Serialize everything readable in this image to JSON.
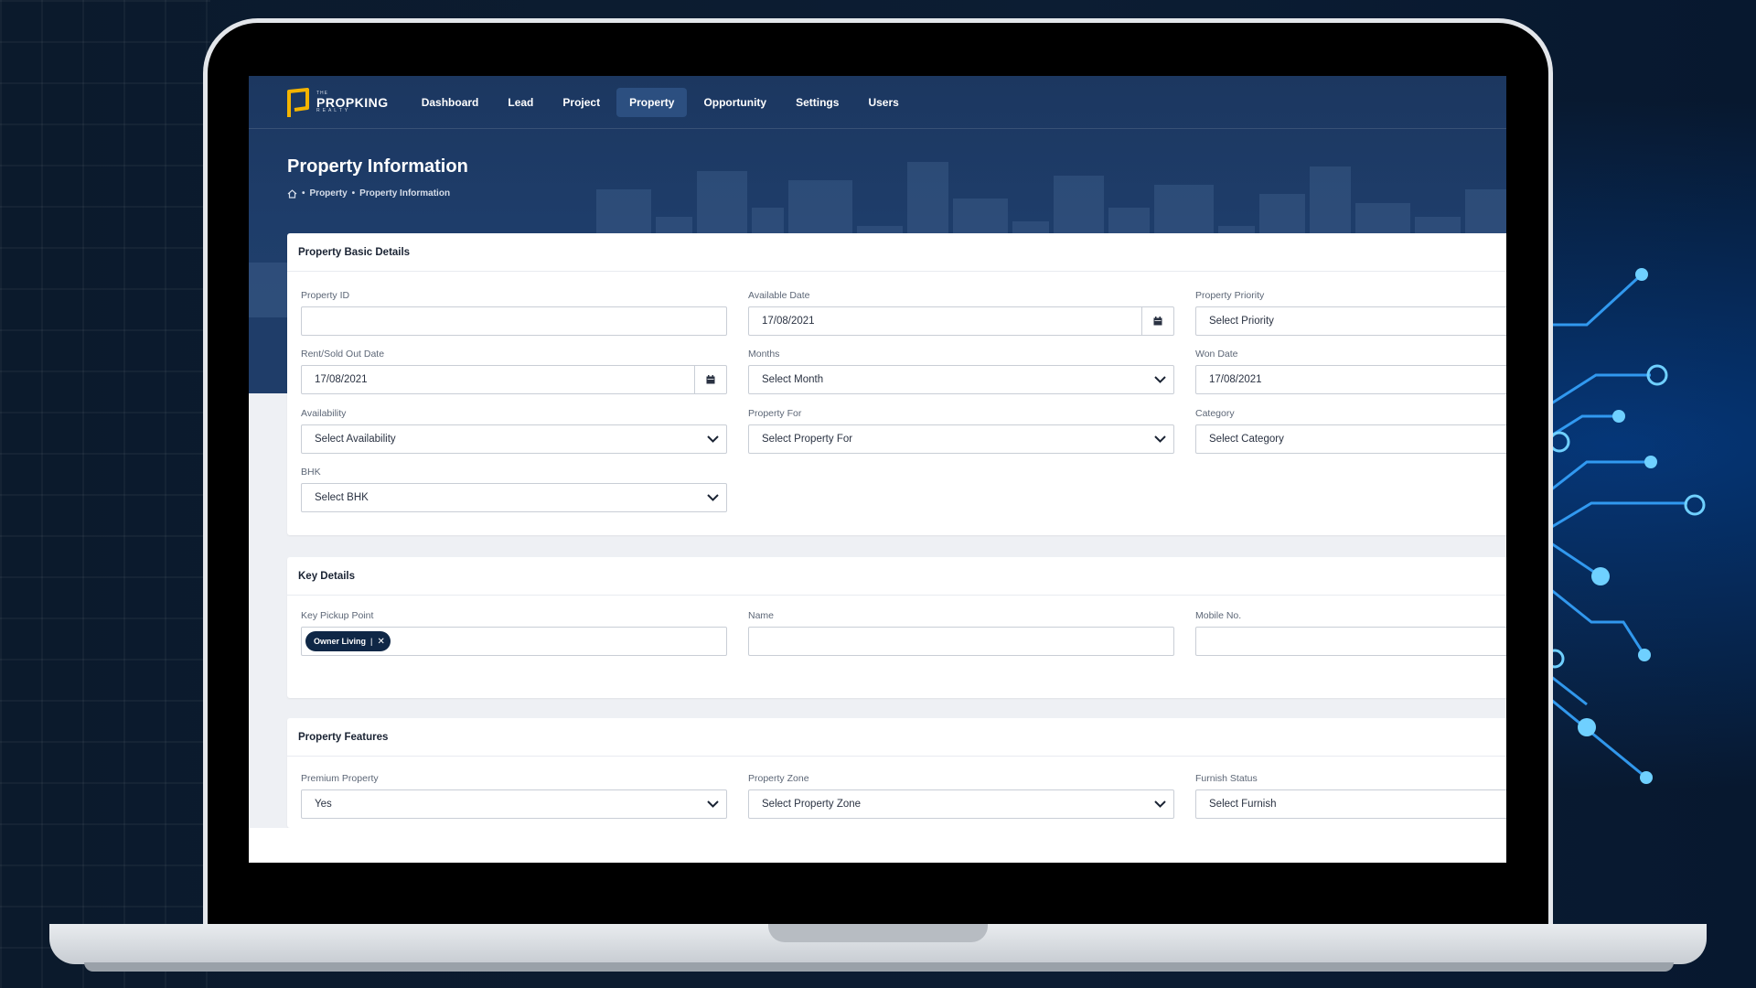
{
  "nav": {
    "logo": {
      "the": "THE",
      "main": "PROPKING",
      "sub": "REALTY"
    },
    "items": [
      {
        "label": "Dashboard",
        "active": false
      },
      {
        "label": "Lead",
        "active": false
      },
      {
        "label": "Project",
        "active": false
      },
      {
        "label": "Property",
        "active": true
      },
      {
        "label": "Opportunity",
        "active": false
      },
      {
        "label": "Settings",
        "active": false
      },
      {
        "label": "Users",
        "active": false
      }
    ]
  },
  "page": {
    "title": "Property Information",
    "breadcrumb": [
      "Property",
      "Property Information"
    ]
  },
  "basic_details": {
    "title": "Property Basic Details",
    "property_id": {
      "label": "Property ID",
      "value": ""
    },
    "available_date": {
      "label": "Available Date",
      "value": "17/08/2021"
    },
    "property_priority": {
      "label": "Property Priority",
      "value": "Select Priority"
    },
    "rent_sold_out_date": {
      "label": "Rent/Sold Out Date",
      "value": "17/08/2021"
    },
    "months": {
      "label": "Months",
      "value": "Select Month"
    },
    "won_date": {
      "label": "Won Date",
      "value": "17/08/2021"
    },
    "availability": {
      "label": "Availability",
      "value": "Select Availability"
    },
    "property_for": {
      "label": "Property For",
      "value": "Select Property For"
    },
    "category": {
      "label": "Category",
      "value": "Select Category"
    },
    "bhk": {
      "label": "BHK",
      "value": "Select BHK"
    }
  },
  "key_details": {
    "title": "Key Details",
    "key_pickup_point": {
      "label": "Key Pickup Point",
      "tag": "Owner Living"
    },
    "name": {
      "label": "Name",
      "value": ""
    },
    "mobile": {
      "label": "Mobile No.",
      "value": ""
    }
  },
  "features": {
    "title": "Property Features",
    "premium_property": {
      "label": "Premium Property",
      "value": "Yes"
    },
    "property_zone": {
      "label": "Property Zone",
      "value": "Select Property Zone"
    },
    "furnish_status": {
      "label": "Furnish Status",
      "value": "Select Furnish"
    }
  },
  "colors": {
    "brand_navy": "#1c3760",
    "logo_gold": "#f4b400",
    "tag_bg": "#0f2746",
    "circuit_blue": "#2f9bff"
  }
}
